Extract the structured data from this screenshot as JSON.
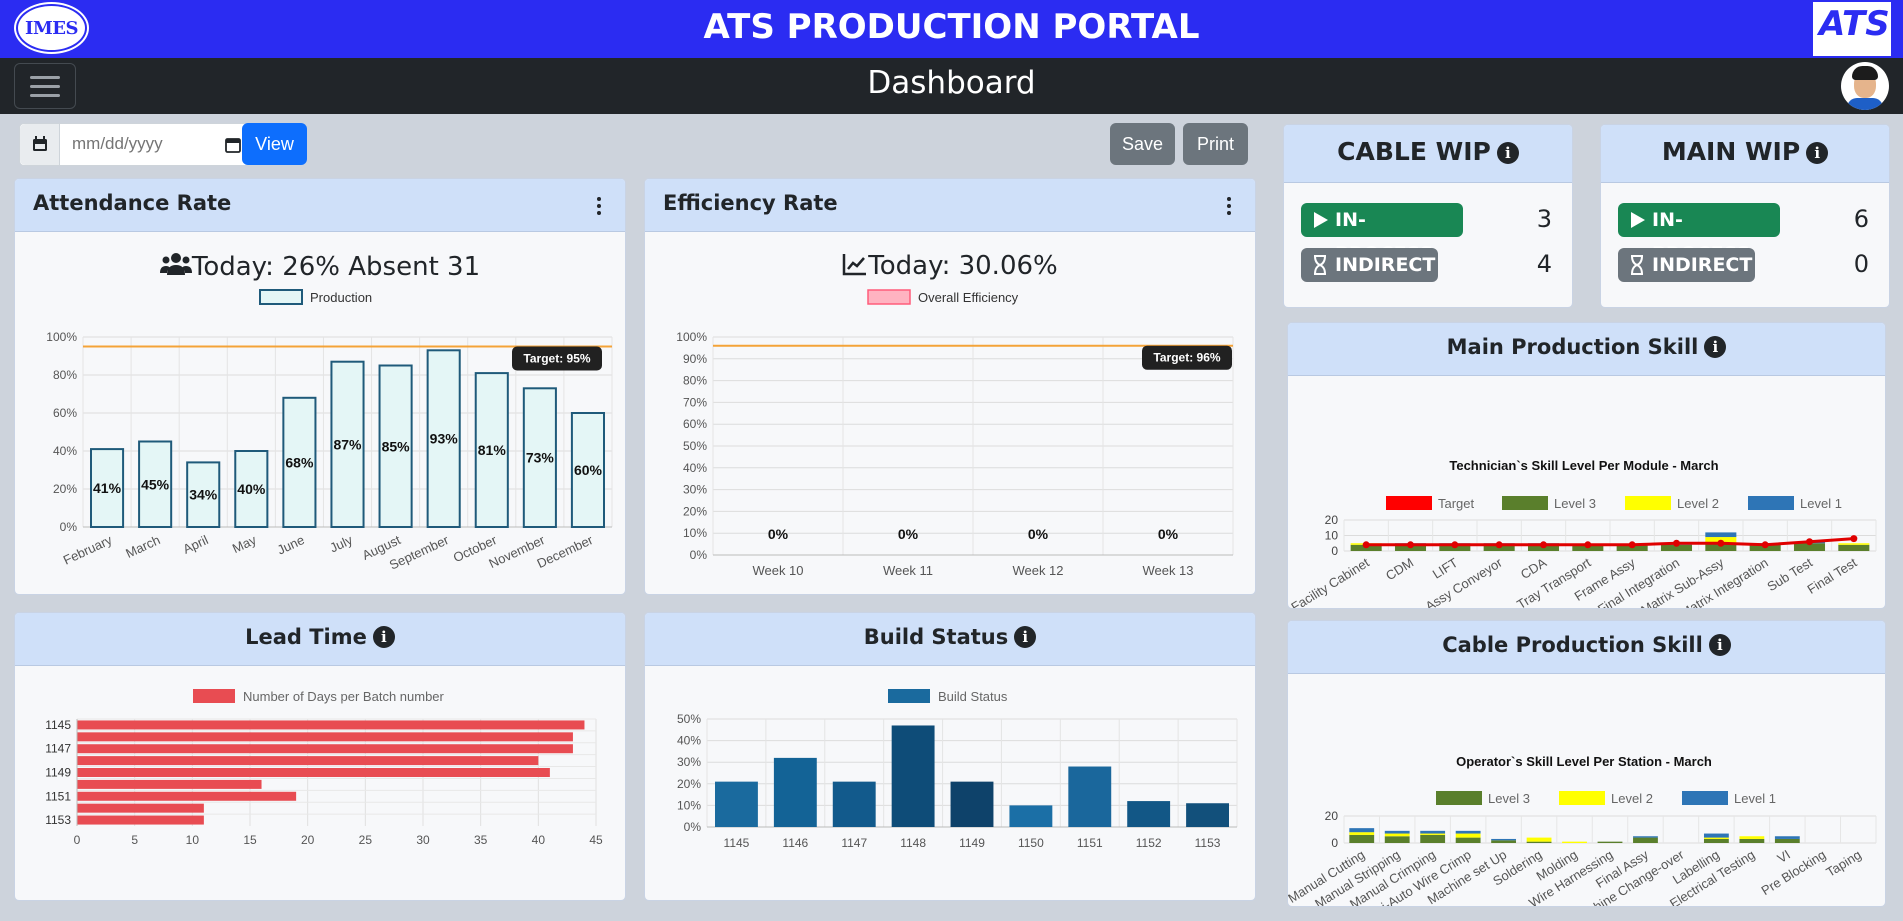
{
  "app": {
    "title": "ATS PRODUCTION PORTAL",
    "logo_left": "IMES",
    "logo_right": "ATS"
  },
  "nav": {
    "title": "Dashboard"
  },
  "toolbar": {
    "date_placeholder": "mm/dd/yyyy",
    "view_label": "View",
    "save_label": "Save",
    "print_label": "Print"
  },
  "colors": {
    "brand": "#2b2cf2",
    "navbar": "#212529",
    "card_header": "#cfe0f9",
    "success": "#198754",
    "secondary": "#6c757d",
    "primary_btn": "#0d6efd"
  },
  "attendance": {
    "title": "Attendance Rate",
    "headline": "Today: 26% Absent 31",
    "chart_data": {
      "type": "bar",
      "legend": [
        "Production"
      ],
      "categories": [
        "February",
        "March",
        "April",
        "May",
        "June",
        "July",
        "August",
        "September",
        "October",
        "November",
        "December"
      ],
      "values": [
        41,
        45,
        34,
        40,
        68,
        87,
        85,
        93,
        81,
        73,
        60
      ],
      "data_labels": [
        "41%",
        "45%",
        "34%",
        "40%",
        "68%",
        "87%",
        "85%",
        "93%",
        "81%",
        "73%",
        "60%"
      ],
      "target": 95,
      "target_label": "Target: 95%",
      "ylim": [
        0,
        100
      ],
      "yticks": [
        "0%",
        "20%",
        "40%",
        "60%",
        "80%",
        "100%"
      ]
    }
  },
  "efficiency": {
    "title": "Efficiency Rate",
    "headline": "Today: 30.06%",
    "chart_data": {
      "type": "bar",
      "legend": [
        "Overall Efficiency"
      ],
      "categories": [
        "Week 10",
        "Week 11",
        "Week 12",
        "Week 13"
      ],
      "values": [
        0,
        0,
        0,
        0
      ],
      "data_labels": [
        "0%",
        "0%",
        "0%",
        "0%"
      ],
      "target": 96,
      "target_label": "Target: 96%",
      "ylim": [
        0,
        100
      ],
      "yticks": [
        "0%",
        "10%",
        "20%",
        "30%",
        "40%",
        "50%",
        "60%",
        "70%",
        "80%",
        "90%",
        "100%"
      ]
    }
  },
  "lead_time": {
    "title": "Lead Time",
    "chart_data": {
      "type": "bar",
      "orientation": "horizontal",
      "legend": [
        "Number of Days per Batch number"
      ],
      "categories": [
        "1145",
        "1146",
        "1147",
        "1148",
        "1149",
        "1150",
        "1151",
        "1152",
        "1153"
      ],
      "y_tick_labels": [
        "1145",
        "1147",
        "1149",
        "1151",
        "1153"
      ],
      "values": [
        44,
        43,
        43,
        40,
        41,
        16,
        19,
        11,
        11
      ],
      "xlim": [
        0,
        45
      ],
      "xticks": [
        "0",
        "5",
        "10",
        "15",
        "20",
        "25",
        "30",
        "35",
        "40",
        "45"
      ]
    }
  },
  "build_status": {
    "title": "Build Status",
    "chart_data": {
      "type": "bar",
      "legend": [
        "Build Status"
      ],
      "categories": [
        "1145",
        "1146",
        "1147",
        "1148",
        "1149",
        "1150",
        "1151",
        "1152",
        "1153"
      ],
      "values": [
        21,
        32,
        21,
        47,
        21,
        10,
        28,
        12,
        11
      ],
      "ylim": [
        0,
        50
      ],
      "yticks": [
        "0%",
        "10%",
        "20%",
        "30%",
        "40%",
        "50%"
      ]
    }
  },
  "cable_wip": {
    "title": "CABLE WIP",
    "in_process_label": "IN-PROCESS",
    "in_process": "3",
    "indirect_label": "INDIRECT",
    "indirect": "4"
  },
  "main_wip": {
    "title": "MAIN WIP",
    "in_process_label": "IN-PROCESS",
    "in_process": "6",
    "indirect_label": "INDIRECT",
    "indirect": "0"
  },
  "main_skill": {
    "title": "Main Production Skill",
    "chart_data": {
      "type": "bar",
      "stacked": true,
      "title": "Technician`s Skill Level Per Module - March",
      "legend": [
        "Target",
        "Level 3",
        "Level 2",
        "Level 1"
      ],
      "categories": [
        "Facility Cabinet",
        "CDM",
        "LIFT",
        "Assy Conveyor",
        "CDA",
        "Tray Transport",
        "Frame Assy",
        "Final Integration",
        "Matrix Sub-Assy",
        "Matrix Integration",
        "Sub Test",
        "Final Test"
      ],
      "series": [
        {
          "name": "Level 3",
          "values": [
            4,
            4,
            4,
            4,
            4,
            4,
            4,
            4,
            5,
            4,
            5,
            4
          ]
        },
        {
          "name": "Level 2",
          "values": [
            1,
            0,
            0,
            0,
            0,
            0,
            0,
            0,
            4,
            0,
            0,
            1
          ]
        },
        {
          "name": "Level 1",
          "values": [
            0,
            1,
            1,
            1,
            1,
            0,
            0,
            1,
            3,
            1,
            1,
            0
          ]
        },
        {
          "name": "Target",
          "values": [
            4,
            4,
            4,
            4,
            4,
            4,
            4,
            5,
            5,
            4,
            6,
            8
          ]
        }
      ],
      "ylim": [
        0,
        20
      ],
      "yticks": [
        "0",
        "10",
        "20"
      ]
    }
  },
  "cable_skill": {
    "title": "Cable Production Skill",
    "chart_data": {
      "type": "bar",
      "stacked": true,
      "title": "Operator`s Skill Level Per Station - March",
      "legend": [
        "Level 3",
        "Level 2",
        "Level 1"
      ],
      "categories": [
        "Manual Cutting",
        "Manual Stripping",
        "Manual Crimping",
        "Semi-Auto Wire Crimp",
        "Machine set Up",
        "Soldering",
        "Molding",
        "Wire Harnessing",
        "Final Assy",
        "Machine Change-over",
        "Labelling",
        "Electrical Testing",
        "VI",
        "Pre Blocking",
        "Taping"
      ],
      "series": [
        {
          "name": "Level 3",
          "values": [
            6,
            5,
            6,
            4,
            2,
            1,
            0,
            1,
            4,
            0,
            3,
            3,
            3,
            0,
            0
          ]
        },
        {
          "name": "Level 2",
          "values": [
            2,
            2,
            1,
            3,
            0,
            3,
            1,
            0,
            0,
            0,
            1,
            2,
            0,
            0,
            0
          ]
        },
        {
          "name": "Level 1",
          "values": [
            3,
            2,
            2,
            2,
            1,
            0,
            0,
            0,
            1,
            0,
            3,
            0,
            2,
            0,
            0
          ]
        }
      ],
      "ylim": [
        0,
        20
      ],
      "yticks": [
        "0",
        "20"
      ]
    }
  }
}
